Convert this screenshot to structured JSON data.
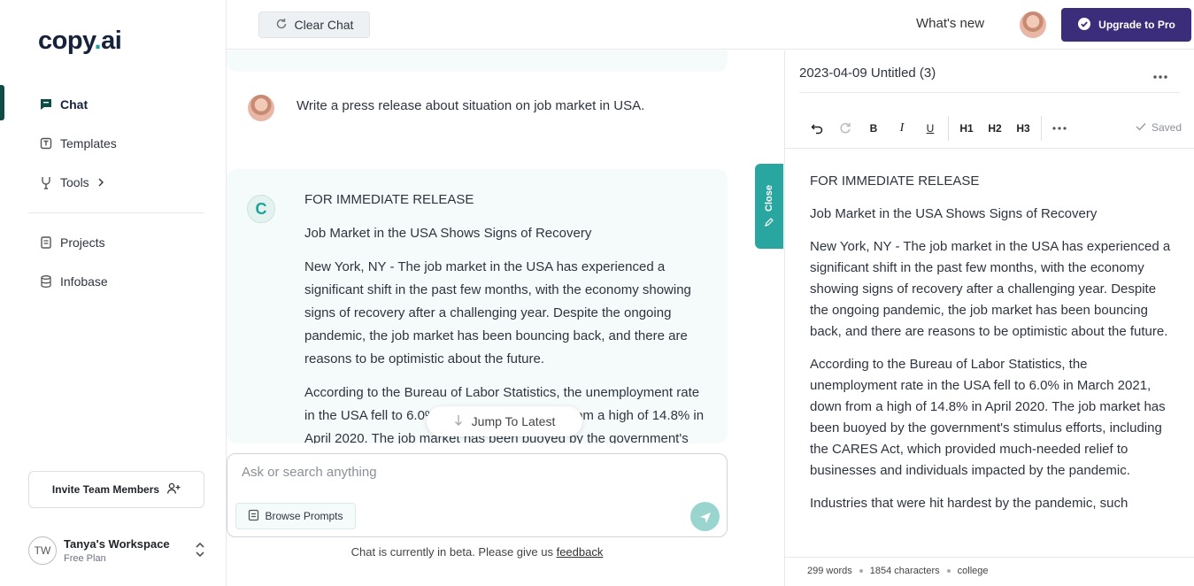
{
  "sidebar": {
    "logo_main": "copy",
    "logo_dot": ".",
    "logo_suffix": "ai",
    "nav": [
      {
        "label": "Chat",
        "icon": "chat-icon"
      },
      {
        "label": "Templates",
        "icon": "template-icon"
      },
      {
        "label": "Tools",
        "icon": "tools-icon"
      }
    ],
    "nav2": [
      {
        "label": "Projects",
        "icon": "document-icon"
      },
      {
        "label": "Infobase",
        "icon": "database-icon"
      }
    ],
    "invite_label": "Invite Team Members",
    "workspace_initials": "TW",
    "workspace_name": "Tanya's Workspace",
    "workspace_plan": "Free Plan"
  },
  "topbar": {
    "clear_chat": "Clear Chat",
    "whats_new": "What's new",
    "upgrade": "Upgrade to Pro"
  },
  "chat": {
    "user_message": "Write a press release about situation on job market in USA.",
    "ai_badge": "C",
    "ai_paragraphs": [
      "FOR IMMEDIATE RELEASE",
      "Job Market in the USA Shows Signs of Recovery",
      "New York, NY - The job market in the USA has experienced a significant shift in the past few months, with the economy showing signs of recovery after a challenging year. Despite the ongoing pandemic, the job market has been bouncing back, and there are reasons to be optimistic about the future.",
      "According to the Bureau of Labor Statistics, the unemployment rate in the USA fell to 6.0% in March 2021, down from a high of 14.8% in April 2020. The job market has been buoyed by the government's stimulus efforts"
    ],
    "jump_label": "Jump To Latest",
    "input_placeholder": "Ask or search anything",
    "browse_prompts": "Browse Prompts",
    "beta_text": "Chat is currently in beta. Please give us ",
    "beta_link": "feedback",
    "close_tab": "Close"
  },
  "editor": {
    "title": "2023-04-09 Untitled (3)",
    "toolbar": {
      "bold": "B",
      "italic": "I",
      "underline": "U",
      "h1": "H1",
      "h2": "H2",
      "h3": "H3"
    },
    "saved": "Saved",
    "paragraphs": [
      "FOR IMMEDIATE RELEASE",
      "Job Market in the USA Shows Signs of Recovery",
      "New York, NY - The job market in the USA has experienced a significant shift in the past few months, with the economy showing signs of recovery after a challenging year. Despite the ongoing pandemic, the job market has been bouncing back, and there are reasons to be optimistic about the future.",
      "According to the Bureau of Labor Statistics, the unemployment rate in the USA fell to 6.0% in March 2021, down from a high of 14.8% in April 2020. The job market has been buoyed by the government's stimulus efforts, including the CARES Act, which provided much-needed relief to businesses and individuals impacted by the pandemic.",
      "Industries that were hit hardest by the pandemic, such"
    ],
    "status": {
      "words": "299 words",
      "characters": "1854 characters",
      "level": "college"
    }
  },
  "colors": {
    "accent": "#1aa39b",
    "upgrade": "#3b2d7a",
    "active_bar": "#0f4c45"
  }
}
